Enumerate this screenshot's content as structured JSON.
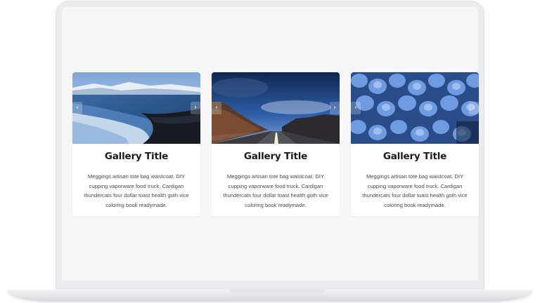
{
  "gallery": {
    "cards": [
      {
        "title": "Gallery Title",
        "text": "Meggings artisan tote bag waistcoat. DIY cupping vaporware food truck. Cardigan thundercats four dollar toast health goth vice coloring book readymade.",
        "image": "beach-waves-mountains",
        "prev_icon": "‹",
        "next_icon": "›"
      },
      {
        "title": "Gallery Title",
        "text": "Meggings artisan tote bag waistcoat. DIY cupping vaporware food truck. Cardigan thundercats four dollar toast health goth vice coloring book readymade.",
        "image": "road-night-sky",
        "prev_icon": "‹",
        "next_icon": "›"
      },
      {
        "title": "Gallery Title",
        "text": "Meggings artisan tote bag waistcoat. DIY cupping vaporware food truck. Cardigan thundercats four dollar toast health goth vice coloring book readymade.",
        "image": "blue-hydrangea-flowers",
        "prev_icon": "‹",
        "next_icon": "›"
      }
    ]
  },
  "colors": {
    "card_background": "#ffffff",
    "screen_background": "#f7f7f8",
    "title": "#1c1c1c",
    "body_text": "#4a4a4a"
  }
}
